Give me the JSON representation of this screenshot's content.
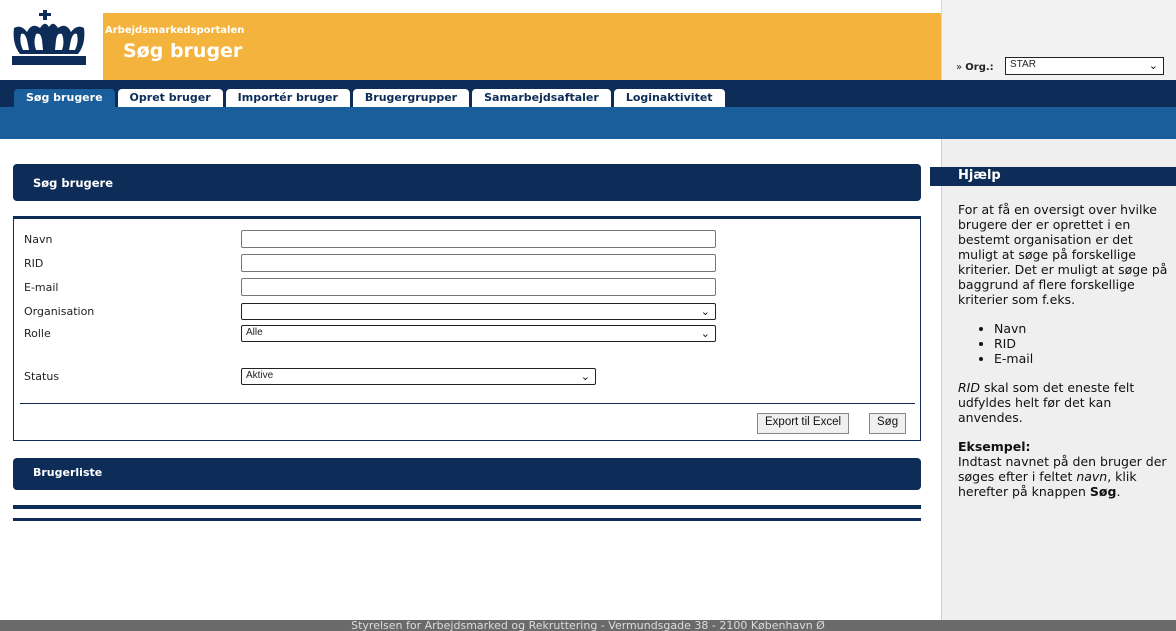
{
  "header": {
    "portal_name": "Arbejdsmarkedsportalen",
    "page_title": "Søg bruger",
    "org_label": "Org.:",
    "org_value": "STAR",
    "colors": {
      "gold": "#f3b33d",
      "navy": "#0d2d58",
      "blue": "#1a5e9c"
    }
  },
  "tabs": [
    {
      "label": "Søg brugere",
      "active": true
    },
    {
      "label": "Opret bruger",
      "active": false
    },
    {
      "label": "Importér bruger",
      "active": false
    },
    {
      "label": "Brugergrupper",
      "active": false
    },
    {
      "label": "Samarbejdsaftaler",
      "active": false
    },
    {
      "label": "Loginaktivitet",
      "active": false
    }
  ],
  "search_panel": {
    "title": "Søg brugere",
    "fields": {
      "navn": {
        "label": "Navn",
        "value": ""
      },
      "rid": {
        "label": "RID",
        "value": ""
      },
      "email": {
        "label": "E-mail",
        "value": ""
      },
      "organisation": {
        "label": "Organisation",
        "value": ""
      },
      "rolle": {
        "label": "Rolle",
        "value": "Alle"
      },
      "status": {
        "label": "Status",
        "value": "Aktive"
      }
    },
    "export_button": "Export til Excel",
    "search_button": "Søg"
  },
  "list_panel": {
    "title": "Brugerliste"
  },
  "help": {
    "title": "Hjælp",
    "intro": "For at få en oversigt over hvilke brugere der er oprettet i en bestemt organisation er det muligt at søge på forskellige kriterier. Det er muligt at søge på baggrund af flere forskellige kriterier som f.eks.",
    "bullets": [
      "Navn",
      "RID",
      "E-mail"
    ],
    "rid_term": "RID",
    "rid_note": " skal som det eneste felt udfyldes helt før det kan anvendes.",
    "example_title": "Eksempel:",
    "example_1": "Indtast navnet på den bruger der søges efter i feltet ",
    "example_field": "navn",
    "example_2": ", klik herefter på knappen ",
    "example_button": "Søg",
    "example_end": "."
  },
  "footer": {
    "text": "Styrelsen for Arbejdsmarked og Rekruttering - Vermundsgade 38 - 2100 København Ø"
  }
}
